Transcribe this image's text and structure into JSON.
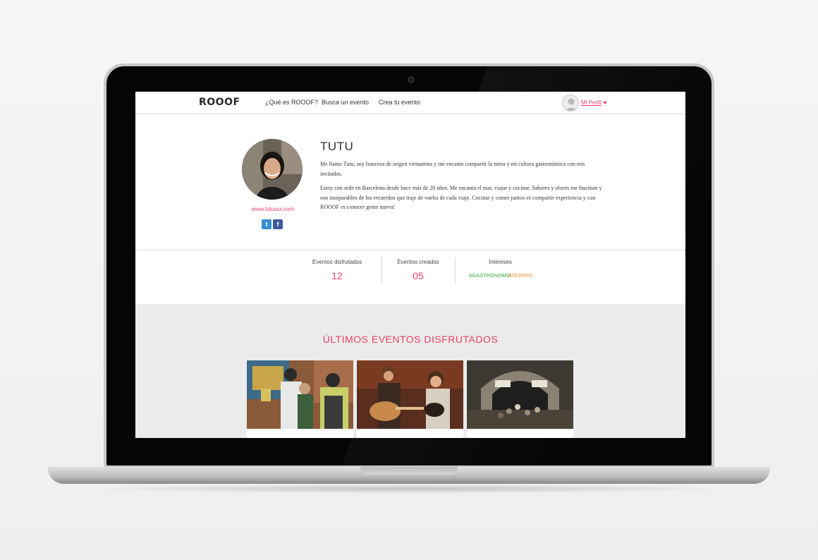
{
  "nav": {
    "logo": "ROOOF",
    "links": [
      "¿Qué es ROOOF?",
      "Busca un evento",
      "Crea tu evento"
    ],
    "profile_label": "Mi Perfil"
  },
  "profile": {
    "name": "TUTU",
    "website": "www.tutuoui.com",
    "bio": [
      "Me llamo Tutu, soy francesa de origen vietnamita y me encanta compartir la mesa y mi cultura gastronómica con mis invitados.",
      "Estoy con sede en Barcelona desde hace más de 20 años. Me encanta el mar, viajar y cocinar. Sabores y olores me fascinan y son inseparables de los recuerdos que traje de vuelta de cada viaje. Cocinar y comer juntos es compartir experiencia y con ROOOF es conocer gente nueva!"
    ],
    "social": [
      {
        "icon": "twitter-icon",
        "glyph": "t",
        "color": "#3a8fd0"
      },
      {
        "icon": "facebook-icon",
        "glyph": "f",
        "color": "#3b5a9a"
      }
    ]
  },
  "stats": {
    "enjoyed": {
      "label": "Eventos disfrutados",
      "value": "12"
    },
    "created": {
      "label": "Eventos creados",
      "value": "05"
    },
    "interests": {
      "label": "Intereses",
      "tags": [
        {
          "text": "#GASTRONOMÍA",
          "color": "#3aa63a"
        },
        {
          "text": "#TEATRO",
          "color": "#f08a2a"
        }
      ]
    }
  },
  "events": {
    "title": "ÚLTIMOS EVENTOS DISFRUTADOS",
    "cards": [
      {
        "image": "street-food-photo"
      },
      {
        "image": "concert-guitar-photo"
      },
      {
        "image": "courtyard-event-photo"
      }
    ]
  },
  "colors": {
    "accent": "#e8416b"
  }
}
